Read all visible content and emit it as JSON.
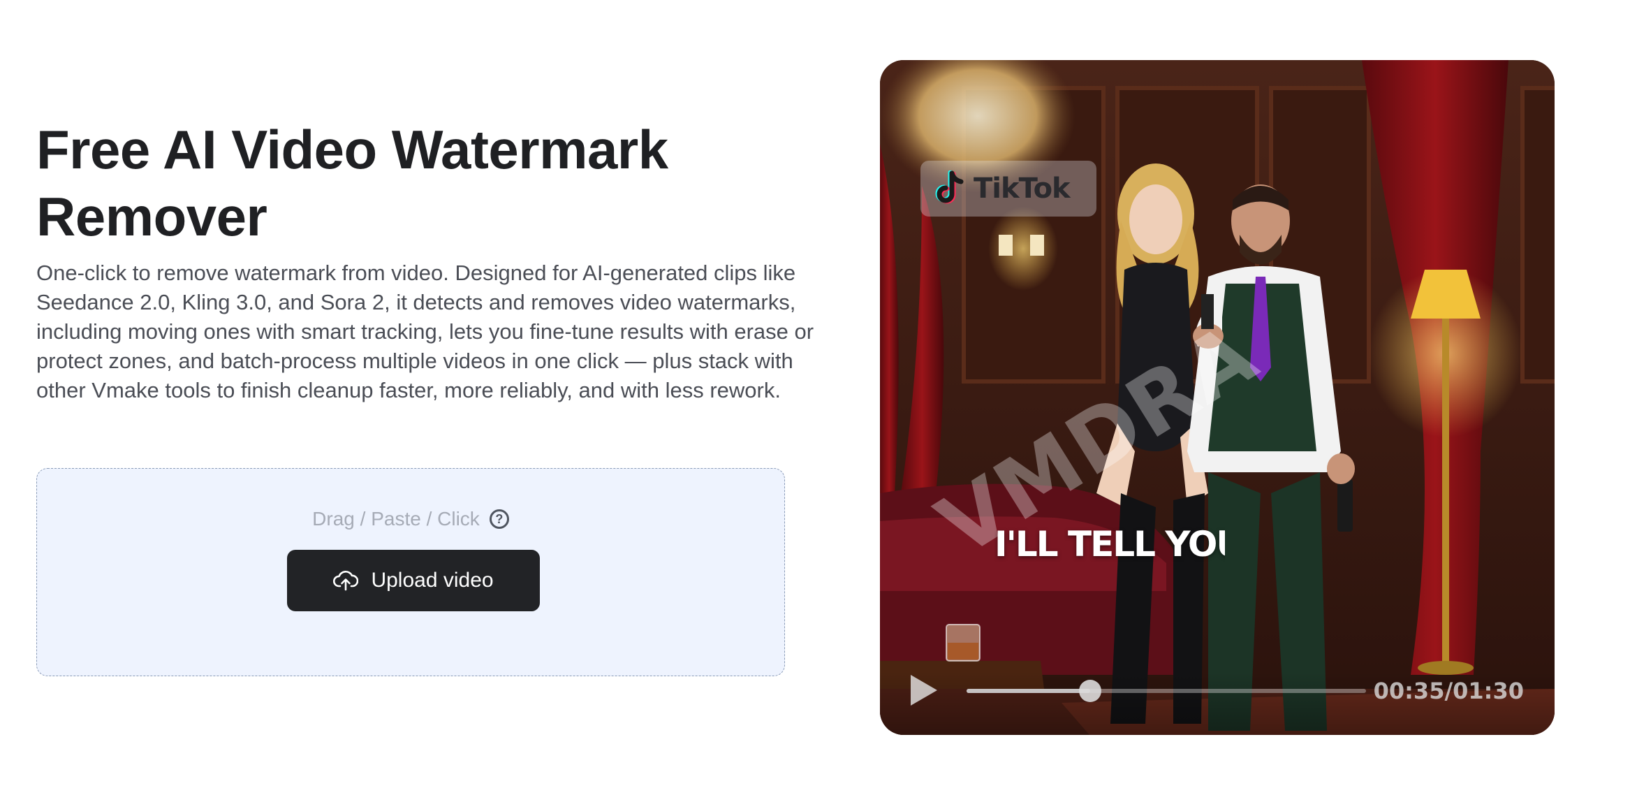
{
  "hero": {
    "title": "Free AI Video Watermark Remover",
    "description": "One-click to remove watermark from video. Designed for AI-generated clips like Seedance 2.0, Kling 3.0, and Sora 2, it detects and removes video watermarks, including moving ones with smart tracking, lets you fine-tune results with erase or protect zones, and batch-process multiple videos in one click — plus stack with other Vmake tools to finish cleanup faster, more reliably, and with less rework."
  },
  "upload": {
    "hint": "Drag / Paste / Click",
    "help_icon": "question-circle-icon",
    "button_label": "Upload video",
    "button_icon": "cloud-upload-icon"
  },
  "preview": {
    "watermark_badge": "TikTok",
    "diagonal_watermark": "VMDRA",
    "caption": "I'LL TELL YOU",
    "player": {
      "current_time": "00:35",
      "duration": "01:30",
      "time_display": "00:35/01:30",
      "progress_fraction": 0.31
    }
  },
  "colors": {
    "upload_bg": "#eef3fe",
    "upload_border": "#8a9bb7",
    "button_bg": "#222326",
    "title": "#1f2023",
    "body_text": "#4a4d55",
    "hint_text": "#a6abb6"
  }
}
